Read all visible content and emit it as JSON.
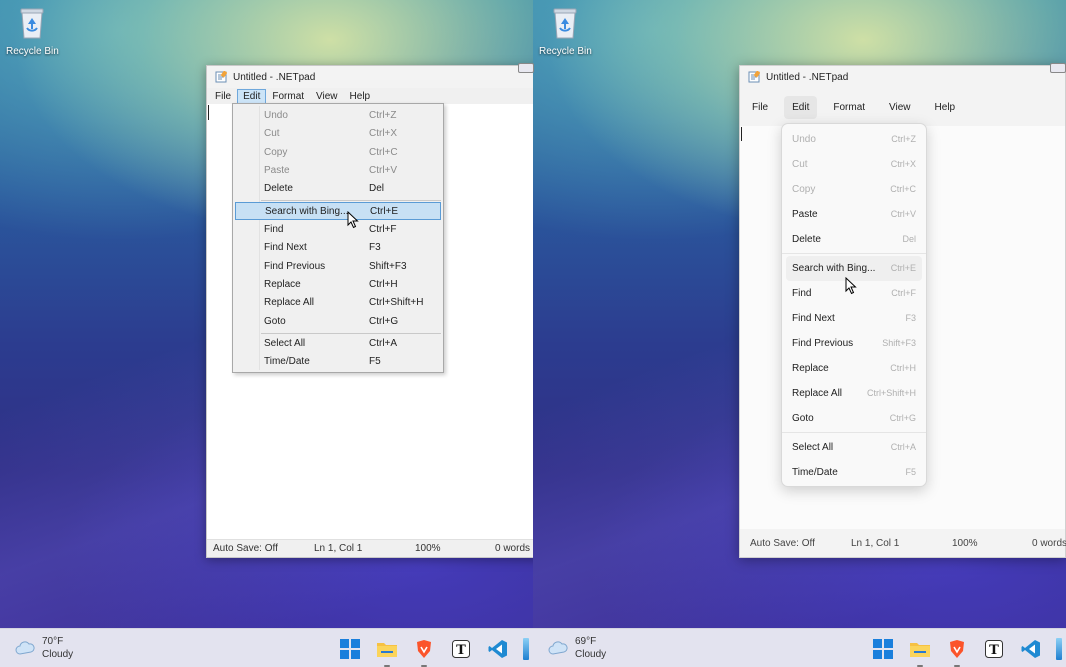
{
  "left": {
    "desktop_icon": "Recycle Bin",
    "window": {
      "title": "Untitled - .NETpad",
      "menus": [
        "File",
        "Edit",
        "Format",
        "View",
        "Help"
      ],
      "active_menu": "Edit",
      "status": {
        "autosave": "Auto Save: Off",
        "position": "Ln 1, Col 1",
        "zoom": "100%",
        "words": "0 words"
      }
    },
    "edit_menu": [
      {
        "label": "Undo",
        "shortcut": "Ctrl+Z",
        "disabled": true
      },
      {
        "label": "Cut",
        "shortcut": "Ctrl+X",
        "disabled": true
      },
      {
        "label": "Copy",
        "shortcut": "Ctrl+C",
        "disabled": true
      },
      {
        "label": "Paste",
        "shortcut": "Ctrl+V",
        "disabled": true
      },
      {
        "label": "Delete",
        "shortcut": "Del",
        "disabled": false
      },
      {
        "label": "Search with Bing...",
        "shortcut": "Ctrl+E",
        "highlighted": true
      },
      {
        "label": "Find",
        "shortcut": "Ctrl+F"
      },
      {
        "label": "Find Next",
        "shortcut": "F3"
      },
      {
        "label": "Find Previous",
        "shortcut": "Shift+F3"
      },
      {
        "label": "Replace",
        "shortcut": "Ctrl+H"
      },
      {
        "label": "Replace All",
        "shortcut": "Ctrl+Shift+H"
      },
      {
        "label": "Goto",
        "shortcut": "Ctrl+G"
      },
      {
        "label": "Select All",
        "shortcut": "Ctrl+A"
      },
      {
        "label": "Time/Date",
        "shortcut": "F5"
      }
    ],
    "weather": {
      "temp": "70°F",
      "condition": "Cloudy"
    }
  },
  "right": {
    "desktop_icon": "Recycle Bin",
    "window": {
      "title": "Untitled - .NETpad",
      "menus": [
        "File",
        "Edit",
        "Format",
        "View",
        "Help"
      ],
      "active_menu": "Edit",
      "status": {
        "autosave": "Auto Save: Off",
        "position": "Ln 1, Col 1",
        "zoom": "100%",
        "words": "0 words"
      }
    },
    "edit_menu": [
      {
        "label": "Undo",
        "shortcut": "Ctrl+Z",
        "disabled": true
      },
      {
        "label": "Cut",
        "shortcut": "Ctrl+X",
        "disabled": true
      },
      {
        "label": "Copy",
        "shortcut": "Ctrl+C",
        "disabled": true
      },
      {
        "label": "Paste",
        "shortcut": "Ctrl+V"
      },
      {
        "label": "Delete",
        "shortcut": "Del"
      },
      {
        "label": "Search with Bing...",
        "shortcut": "Ctrl+E",
        "highlighted": true
      },
      {
        "label": "Find",
        "shortcut": "Ctrl+F"
      },
      {
        "label": "Find Next",
        "shortcut": "F3"
      },
      {
        "label": "Find Previous",
        "shortcut": "Shift+F3"
      },
      {
        "label": "Replace",
        "shortcut": "Ctrl+H"
      },
      {
        "label": "Replace All",
        "shortcut": "Ctrl+Shift+H"
      },
      {
        "label": "Goto",
        "shortcut": "Ctrl+G"
      },
      {
        "label": "Select All",
        "shortcut": "Ctrl+A"
      },
      {
        "label": "Time/Date",
        "shortcut": "F5"
      }
    ],
    "weather": {
      "temp": "69°F",
      "condition": "Cloudy"
    }
  },
  "taskbar_apps": [
    "windows-start-icon",
    "file-explorer-icon",
    "brave-browser-icon",
    "typora-icon",
    "vscode-icon"
  ],
  "colors": {
    "taskbar": "#e3e3ef",
    "menu_highlight": "#c7e0f4",
    "menu_border": "#5a9bd5"
  }
}
